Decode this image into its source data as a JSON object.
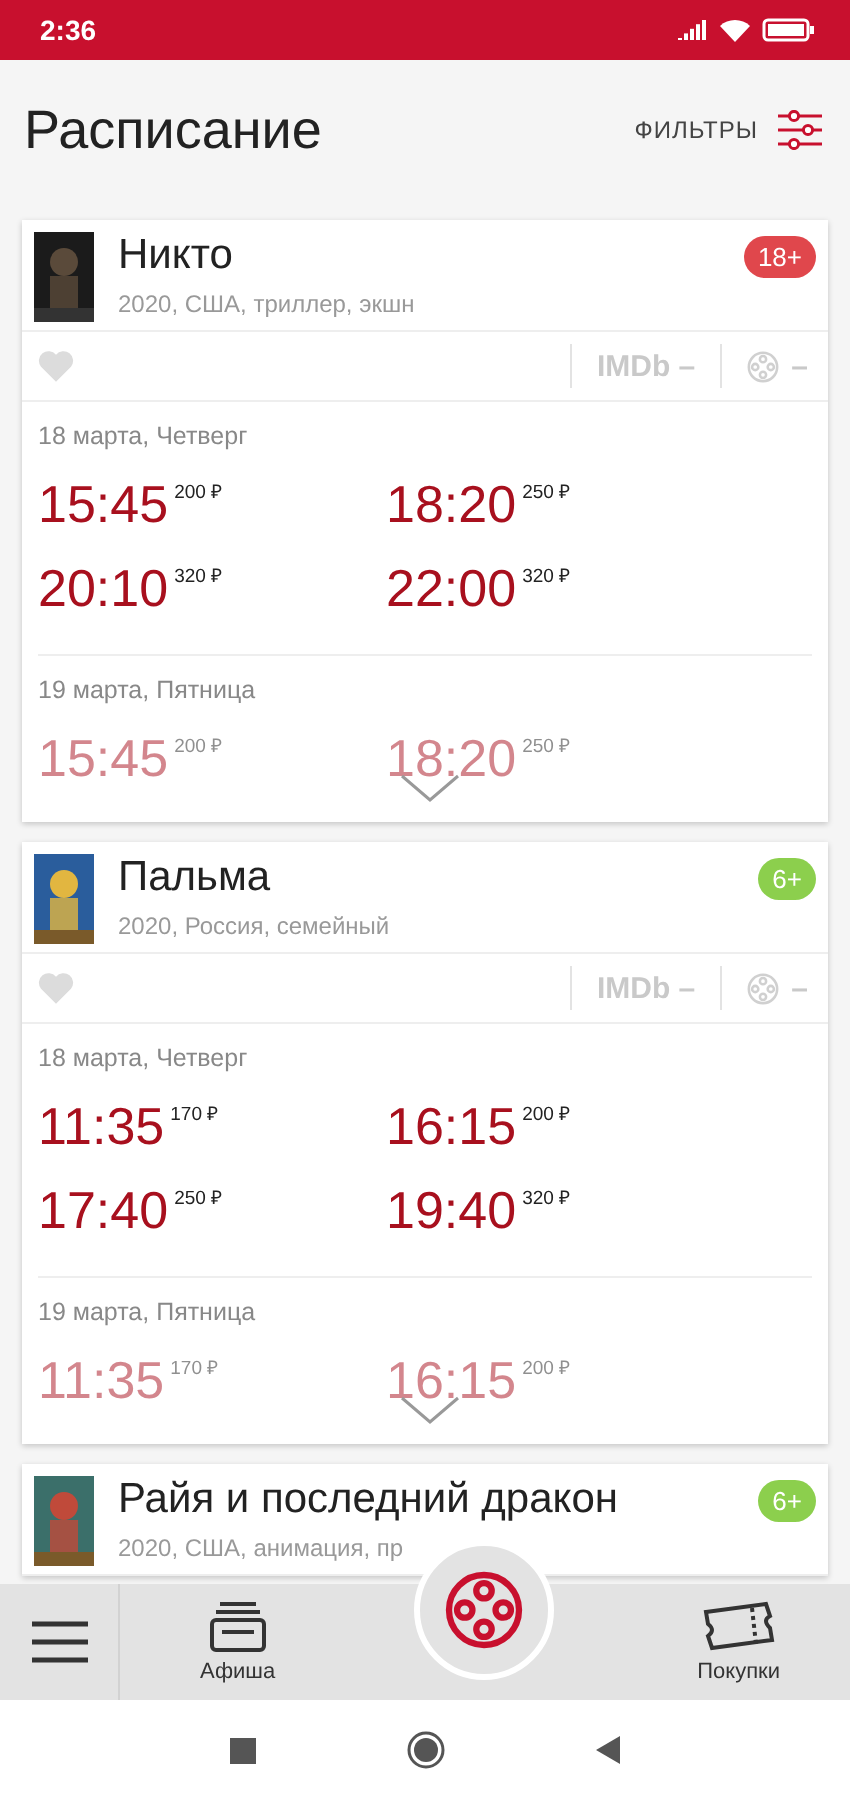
{
  "status_bar": {
    "time": "2:36"
  },
  "header": {
    "title": "Расписание",
    "filters": "ФИЛЬТРЫ"
  },
  "movies": [
    {
      "title": "Никто",
      "info": "2020, США, триллер, экшн",
      "age": "18+",
      "color": "#e0474c",
      "imdb": "IMDb –",
      "kp": "–",
      "collapsed": true,
      "days": [
        {
          "date": "18 марта, Четверг",
          "sessions": [
            {
              "time": "15:45",
              "price": "200 ₽"
            },
            {
              "time": "18:20",
              "price": "250 ₽"
            },
            {
              "time": "20:10",
              "price": "320 ₽"
            },
            {
              "time": "22:00",
              "price": "320 ₽"
            }
          ]
        },
        {
          "date": "19 марта, Пятница",
          "sessions": [
            {
              "time": "15:45",
              "price": "200 ₽"
            },
            {
              "time": "18:20",
              "price": "250 ₽"
            }
          ]
        }
      ]
    },
    {
      "title": "Пальма",
      "info": "2020, Россия, семейный",
      "age": "6+",
      "color": "#8ccf4d",
      "imdb": "IMDb –",
      "kp": "–",
      "collapsed": true,
      "days": [
        {
          "date": "18 марта, Четверг",
          "sessions": [
            {
              "time": "11:35",
              "price": "170 ₽"
            },
            {
              "time": "16:15",
              "price": "200 ₽"
            },
            {
              "time": "17:40",
              "price": "250 ₽"
            },
            {
              "time": "19:40",
              "price": "320 ₽"
            }
          ]
        },
        {
          "date": "19 марта, Пятница",
          "sessions": [
            {
              "time": "11:35",
              "price": "170 ₽"
            },
            {
              "time": "16:15",
              "price": "200 ₽"
            }
          ]
        }
      ]
    },
    {
      "title": "Райя и последний дракон",
      "info": "2020, США, анимация, пр",
      "age": "6+",
      "color": "#8ccf4d"
    }
  ],
  "bottom_nav": {
    "items": [
      {
        "label": "Афиша",
        "selected": false
      },
      {
        "label": "Покупки",
        "selected": false
      }
    ]
  }
}
